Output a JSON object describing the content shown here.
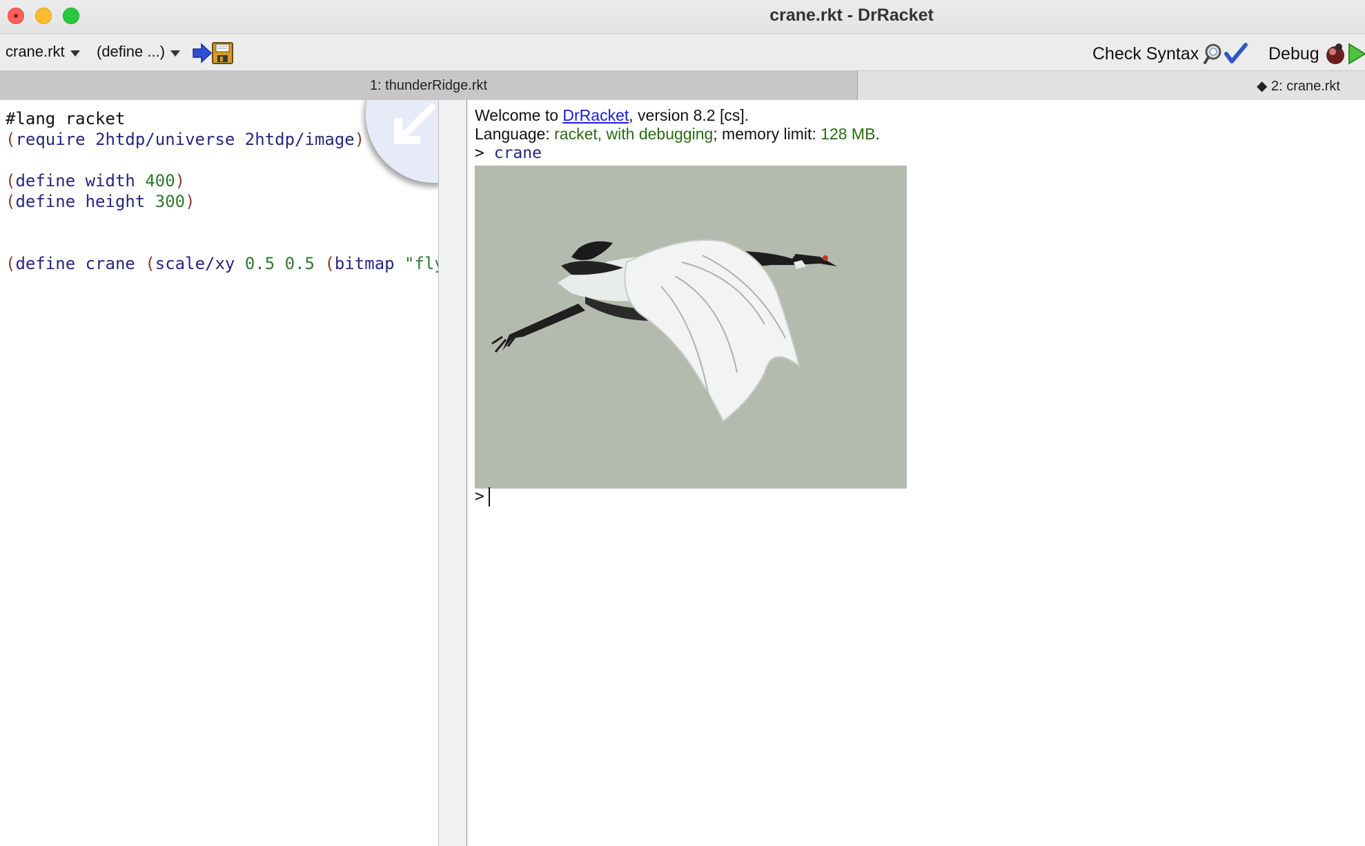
{
  "window": {
    "title": "crane.rkt - DrRacket"
  },
  "toolbar": {
    "file_menu_label": "crane.rkt",
    "define_menu_label": "(define ...)",
    "check_syntax_label": "Check Syntax",
    "debug_label": "Debug"
  },
  "tabs": [
    {
      "label": "1: thunderRidge.rkt",
      "active": false
    },
    {
      "label": "◆ 2: crane.rkt",
      "active": true
    }
  ],
  "editor": {
    "lines": {
      "l1": "#lang racket",
      "l2_kw": "require",
      "l2_args": "2htdp/universe 2htdp/image",
      "l4_kw": "define",
      "l4_name": "width",
      "l4_val": "400",
      "l5_kw": "define",
      "l5_name": "height",
      "l5_val": "300",
      "l8_kw": "define",
      "l8_name": "crane",
      "l8_fn": "scale/xy",
      "l8_a": "0.5",
      "l8_b": "0.5",
      "l8_fn2": "bitmap",
      "l8_str": "\"fly"
    }
  },
  "interactions": {
    "welcome_prefix": "Welcome to ",
    "welcome_link": "DrRacket",
    "welcome_suffix": ", version 8.2 [cs].",
    "lang_prefix": "Language: ",
    "lang_value": "racket, with debugging",
    "lang_mid": "; memory limit: ",
    "mem_value": "128 MB",
    "lang_end": ".",
    "prompt_symbol": ">",
    "prompt_expr": "crane",
    "prompt2_symbol": ">"
  },
  "colors": {
    "keyword_paren": "#8b3a2a",
    "identifier": "#262681",
    "constant": "#2e7a2e",
    "image_bg": "#b4baad"
  }
}
